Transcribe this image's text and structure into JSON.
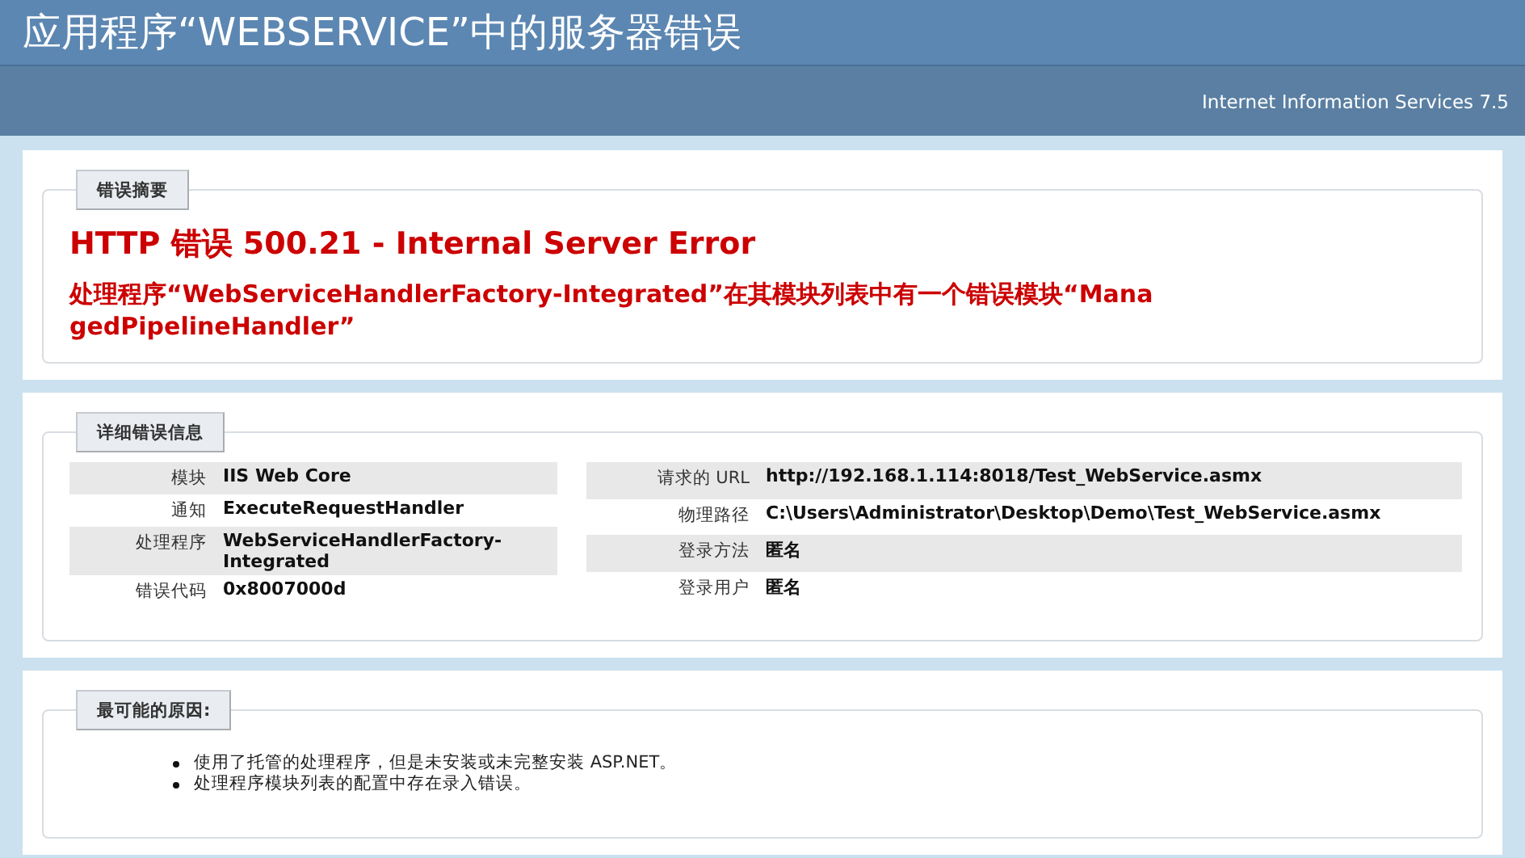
{
  "header": {
    "title": "应用程序“WEBSERVICE”中的服务器错误",
    "product": "Internet Information Services 7.5"
  },
  "summary": {
    "legend": "错误摘要",
    "heading": "HTTP 错误 500.21 - Internal Server Error",
    "message": "处理程序“WebServiceHandlerFactory-Integrated”在其模块列表中有一个错误模块“ManagedPipelineHandler”"
  },
  "details": {
    "legend": "详细错误信息",
    "left": [
      {
        "label": "模块",
        "value": "IIS Web Core"
      },
      {
        "label": "通知",
        "value": "ExecuteRequestHandler"
      },
      {
        "label": "处理程序",
        "value": "WebServiceHandlerFactory-Integrated"
      },
      {
        "label": "错误代码",
        "value": "0x8007000d"
      }
    ],
    "right": [
      {
        "label": "请求的 URL",
        "value": "http://192.168.1.114:8018/Test_WebService.asmx"
      },
      {
        "label": "物理路径",
        "value": "C:\\Users\\Administrator\\Desktop\\Demo\\Test_WebService.asmx"
      },
      {
        "label": "登录方法",
        "value": "匿名"
      },
      {
        "label": "登录用户",
        "value": "匿名"
      }
    ]
  },
  "causes": {
    "legend": "最可能的原因:",
    "items": [
      "使用了托管的处理程序，但是未安装或未完整安装 ASP.NET。",
      "处理程序模块列表的配置中存在录入错误。"
    ]
  }
}
